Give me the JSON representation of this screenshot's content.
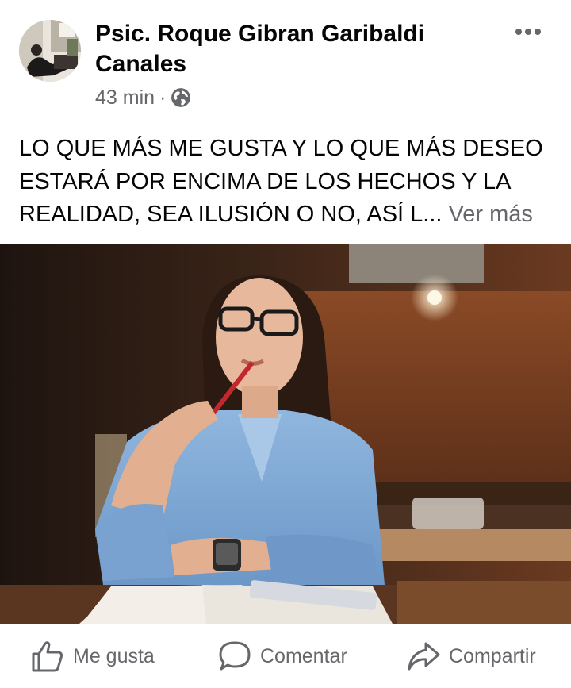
{
  "post": {
    "author": "Psic. Roque Gibran Garibaldi Canales",
    "time": "43 min",
    "separator": "·",
    "privacy_icon": "globe-icon",
    "more_icon": "more-horizontal-icon",
    "text": "LO QUE MÁS ME GUSTA Y LO QUE MÁS DESEO ESTARÁ POR ENCIMA DE LOS HECHOS Y LA REALIDAD, SEA ILUSIÓN O NO, ASÍ L...",
    "see_more": "Ver más"
  },
  "actions": {
    "like": {
      "label": "Me gusta",
      "icon": "thumbs-up-icon"
    },
    "comment": {
      "label": "Comentar",
      "icon": "comment-icon"
    },
    "share": {
      "label": "Compartir",
      "icon": "share-icon"
    }
  },
  "colors": {
    "text_primary": "#050505",
    "text_secondary": "#65676b",
    "background": "#ffffff"
  }
}
